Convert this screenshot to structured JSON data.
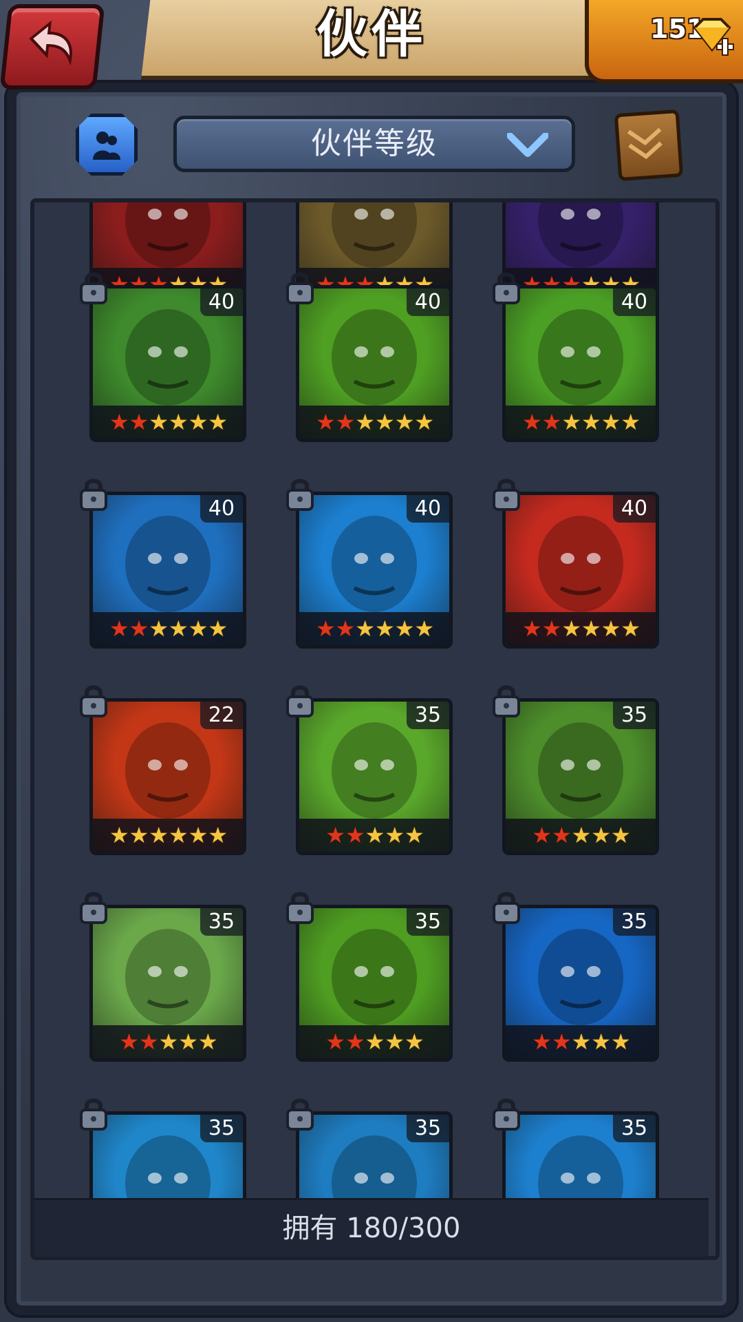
{
  "header": {
    "title": "伙伴",
    "gems": "151",
    "back_icon": "back-arrow-icon",
    "gem_icon": "diamond-plus-icon"
  },
  "filter": {
    "friend_icon": "friend-icon",
    "sort_label": "伙伴等级",
    "dropdown_icon": "chevron-down-icon",
    "map_icon": "map-scroll-icon"
  },
  "partners": [
    {
      "level": "",
      "stars_red": 3,
      "stars_gold": 3,
      "bg": "#8b1d1d",
      "partial": true
    },
    {
      "level": "",
      "stars_red": 3,
      "stars_gold": 3,
      "bg": "#6d5a2a",
      "partial": true
    },
    {
      "level": "",
      "stars_red": 3,
      "stars_gold": 3,
      "bg": "#35206a",
      "partial": true
    },
    {
      "level": "40",
      "stars_red": 2,
      "stars_gold": 4,
      "bg": "#3e8a2c",
      "partial": false
    },
    {
      "level": "40",
      "stars_red": 2,
      "stars_gold": 4,
      "bg": "#4f9f23",
      "partial": false
    },
    {
      "level": "40",
      "stars_red": 2,
      "stars_gold": 4,
      "bg": "#4b9f25",
      "partial": false
    },
    {
      "level": "40",
      "stars_red": 2,
      "stars_gold": 4,
      "bg": "#1f6fbf",
      "partial": false
    },
    {
      "level": "40",
      "stars_red": 2,
      "stars_gold": 4,
      "bg": "#1c7fd0",
      "partial": false
    },
    {
      "level": "40",
      "stars_red": 2,
      "stars_gold": 4,
      "bg": "#c52a1f",
      "partial": false
    },
    {
      "level": "22",
      "stars_red": 0,
      "stars_gold": 6,
      "bg": "#c33716",
      "partial": false
    },
    {
      "level": "35",
      "stars_red": 2,
      "stars_gold": 3,
      "bg": "#5aa82b",
      "partial": false
    },
    {
      "level": "35",
      "stars_red": 2,
      "stars_gold": 3,
      "bg": "#4d8e2b",
      "partial": false
    },
    {
      "level": "35",
      "stars_red": 2,
      "stars_gold": 3,
      "bg": "#6aa84a",
      "partial": false
    },
    {
      "level": "35",
      "stars_red": 2,
      "stars_gold": 3,
      "bg": "#4f9e22",
      "partial": false
    },
    {
      "level": "35",
      "stars_red": 2,
      "stars_gold": 3,
      "bg": "#1666c4",
      "partial": false
    },
    {
      "level": "35",
      "stars_red": 0,
      "stars_gold": 0,
      "bg": "#1f86c9",
      "partial": false
    },
    {
      "level": "35",
      "stars_red": 0,
      "stars_gold": 0,
      "bg": "#1e7cc0",
      "partial": false
    },
    {
      "level": "35",
      "stars_red": 0,
      "stars_gold": 0,
      "bg": "#1d80cf",
      "partial": false
    }
  ],
  "footer": {
    "owned": "拥有 180/300"
  }
}
